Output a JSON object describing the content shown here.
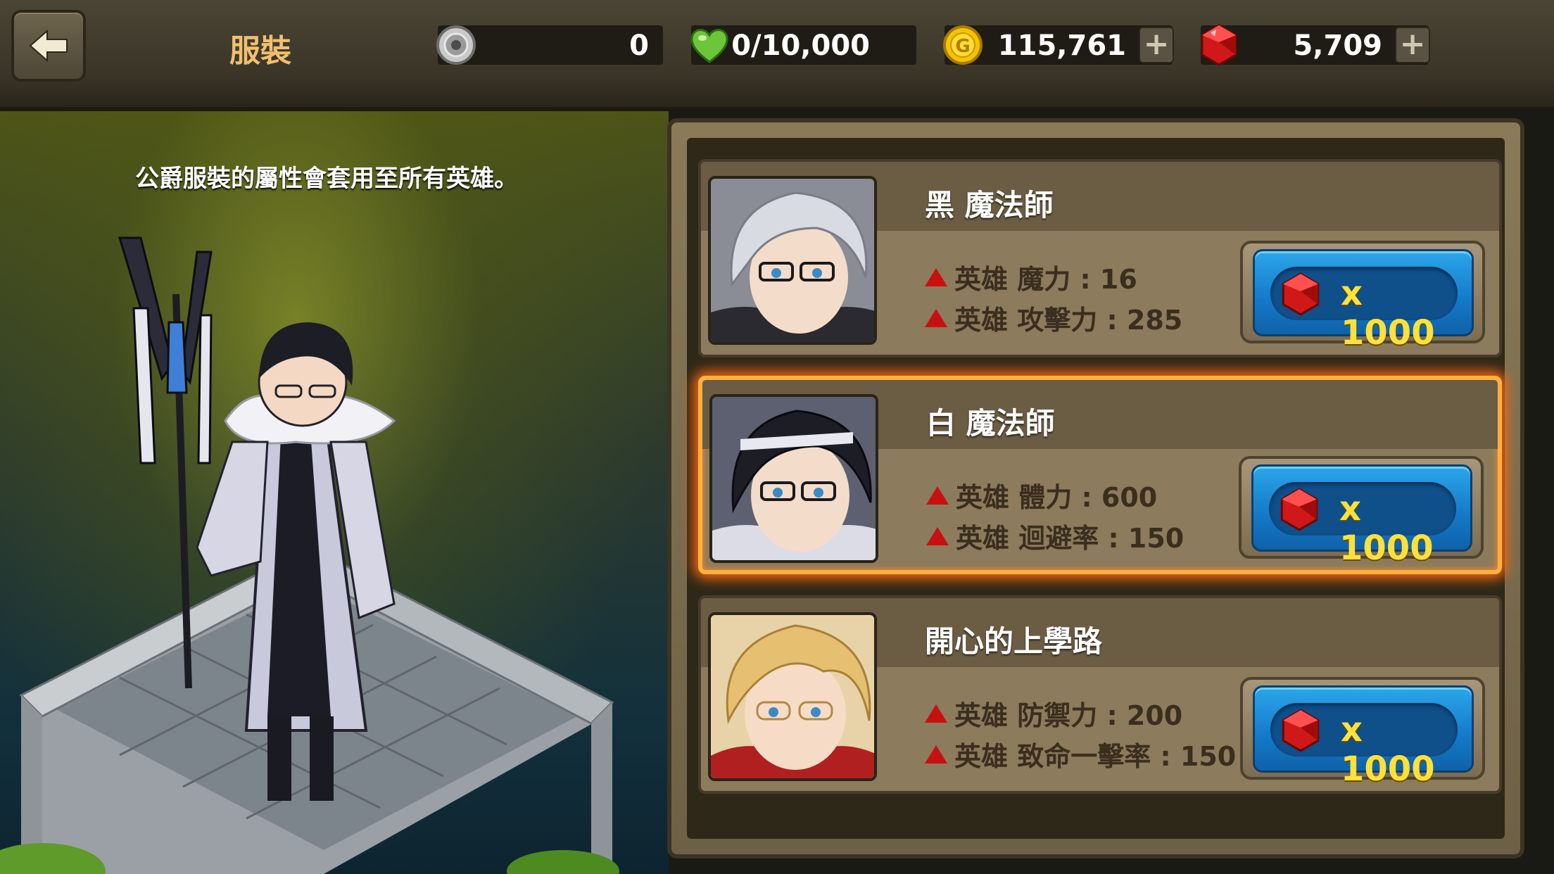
{
  "header": {
    "title": "服裝",
    "resources": [
      {
        "name": "silver-token",
        "value": "0",
        "has_plus": false
      },
      {
        "name": "stamina",
        "value": "0/10,000",
        "has_plus": false
      },
      {
        "name": "gold",
        "value": "115,761",
        "has_plus": true
      },
      {
        "name": "ruby",
        "value": "5,709",
        "has_plus": true
      }
    ],
    "plus_label": "+"
  },
  "scene": {
    "note": "公爵服裝的屬性會套用至所有英雄。"
  },
  "costumes": [
    {
      "name": "黑 魔法師",
      "stats": [
        "英雄 魔力 : 16",
        "英雄 攻擊力 : 285"
      ],
      "cost": "x 1000",
      "selected": false
    },
    {
      "name": "白 魔法師",
      "stats": [
        "英雄 體力 : 600",
        "英雄 迴避率 : 150"
      ],
      "cost": "x 1000",
      "selected": true
    },
    {
      "name": "開心的上學路",
      "stats": [
        "英雄 防禦力 : 200",
        "英雄 致命一擊率 : 150"
      ],
      "cost": "x 1000",
      "selected": false
    }
  ],
  "colors": {
    "accent_title": "#f0c070",
    "cost_text": "#ffe13a",
    "button_blue": "#1478c8",
    "selected_glow": "#ff6a10",
    "stat_arrow": "#c81010"
  }
}
